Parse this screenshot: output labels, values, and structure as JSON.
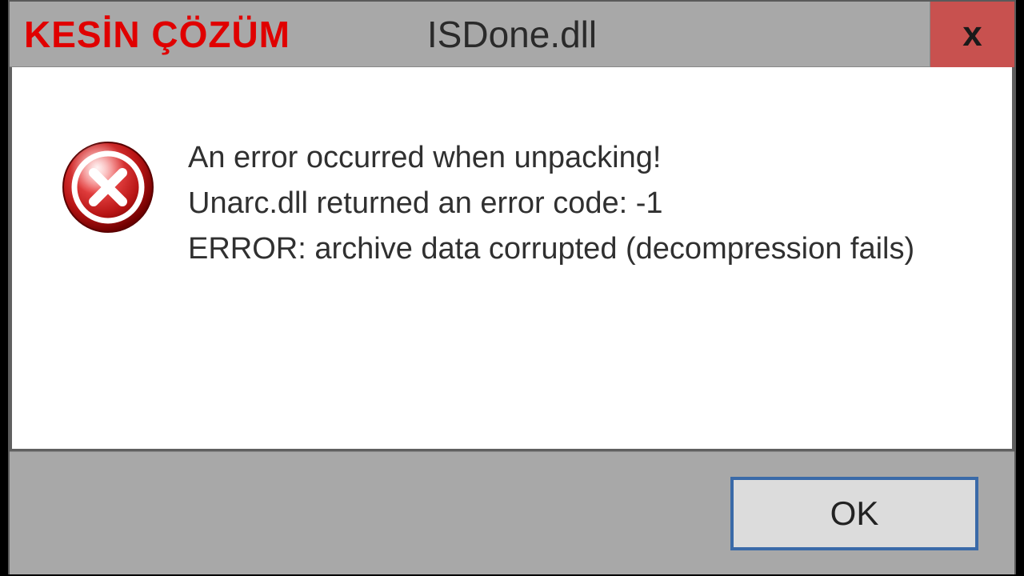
{
  "overlay": {
    "caption": "KESİN ÇÖZÜM"
  },
  "window": {
    "title": "ISDone.dll",
    "close_label": "x"
  },
  "message": {
    "line1": "An error occurred when unpacking!",
    "line2": "Unarc.dll returned an error code: -1",
    "line3": "ERROR: archive data corrupted (decompression fails)"
  },
  "buttons": {
    "ok": "OK"
  },
  "icon": {
    "name": "error-icon"
  }
}
